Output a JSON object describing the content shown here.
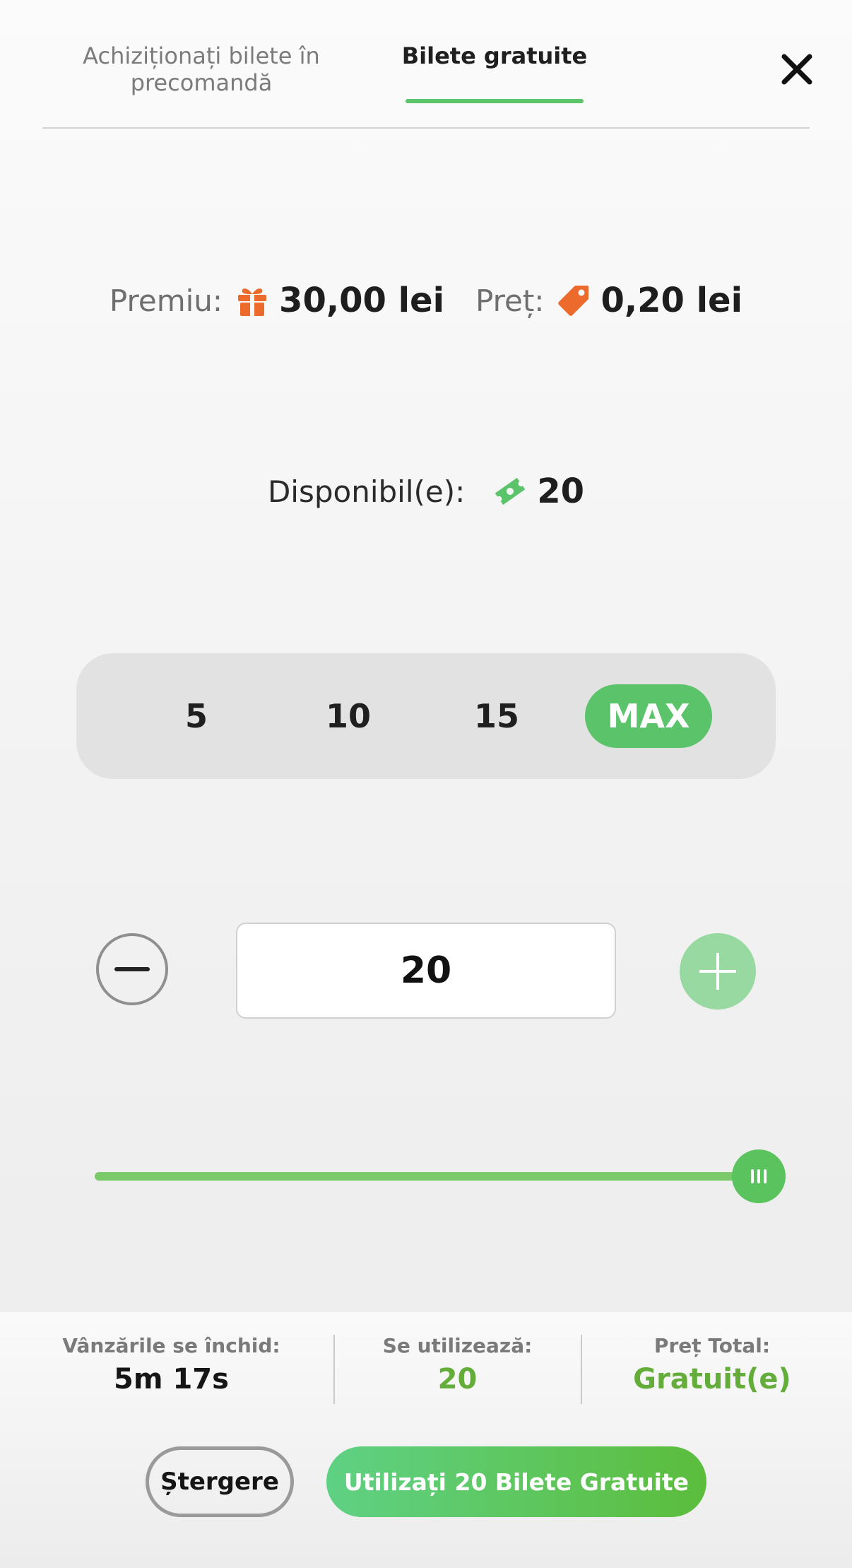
{
  "tabs": {
    "preorder_line1": "Achiziționați bilete în",
    "preorder_line2": "precomandă",
    "free": "Bilete gratuite"
  },
  "icons": {
    "close": "close-icon",
    "prize": "gift-icon",
    "price": "price-tag-icon",
    "available": "ticket-icon",
    "minus": "minus-icon",
    "plus": "plus-icon",
    "slider_handle": "grip-icon"
  },
  "prize": {
    "label": "Premiu:",
    "value": "30,00 lei"
  },
  "price": {
    "label": "Preț:",
    "value": "0,20 lei"
  },
  "available": {
    "label": "Disponibil(e):",
    "value": "20"
  },
  "quick_picks": [
    "5",
    "10",
    "15",
    "MAX"
  ],
  "quick_selected": "MAX",
  "stepper": {
    "value": "20"
  },
  "slider": {
    "value": 20,
    "max": 20
  },
  "summary": {
    "closes_label": "Vânzările se închid:",
    "closes_value": "5m 17s",
    "used_label": "Se utilizează:",
    "used_value": "20",
    "total_label": "Preț Total:",
    "total_value": "Gratuit(e)"
  },
  "actions": {
    "clear": "Ștergere",
    "use": "Utilizați 20 Bilete Gratuite"
  },
  "colors": {
    "accent_green": "#5bc46a",
    "value_green": "#64ad3a",
    "orange": "#ec6a2c"
  }
}
